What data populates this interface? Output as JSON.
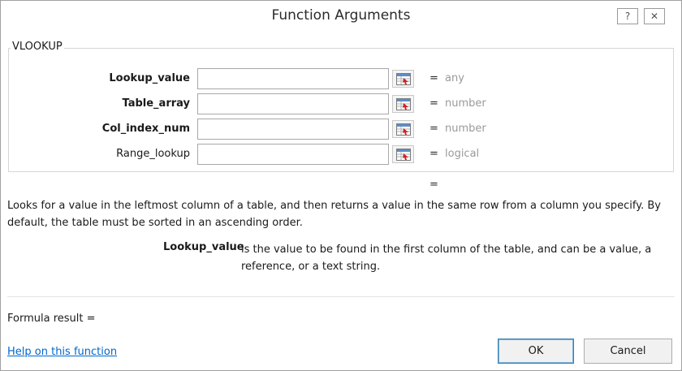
{
  "window": {
    "title": "Function Arguments",
    "help_glyph": "?",
    "close_glyph": "✕",
    "icons": [
      "help-icon",
      "close-icon"
    ]
  },
  "function_group": {
    "name": "VLOOKUP",
    "arguments": [
      {
        "label": "Lookup_value",
        "required": true,
        "value": "",
        "equals": "=",
        "type_hint": "any"
      },
      {
        "label": "Table_array",
        "required": true,
        "value": "",
        "equals": "=",
        "type_hint": "number"
      },
      {
        "label": "Col_index_num",
        "required": true,
        "value": "",
        "equals": "=",
        "type_hint": "number"
      },
      {
        "label": "Range_lookup",
        "required": false,
        "value": "",
        "equals": "=",
        "type_hint": "logical"
      }
    ],
    "ref_button_icon": "collapse-dialog-icon"
  },
  "result_equals": "=",
  "description": "Looks for a value in the leftmost column of a table, and then returns a value in the same row from a column you specify. By default, the table must be sorted in an ascending order.",
  "argument_help": {
    "name": "Lookup_value",
    "text": "is the value to be found in the first column of the table, and can be a value, a reference, or a text string."
  },
  "formula_result": "Formula result =",
  "help_link": "Help on this function",
  "buttons": {
    "ok": "OK",
    "cancel": "Cancel"
  },
  "colors": {
    "link": "#0066cc",
    "type_hint": "#9a9a9a",
    "default_button_border": "#3c7fb1"
  }
}
